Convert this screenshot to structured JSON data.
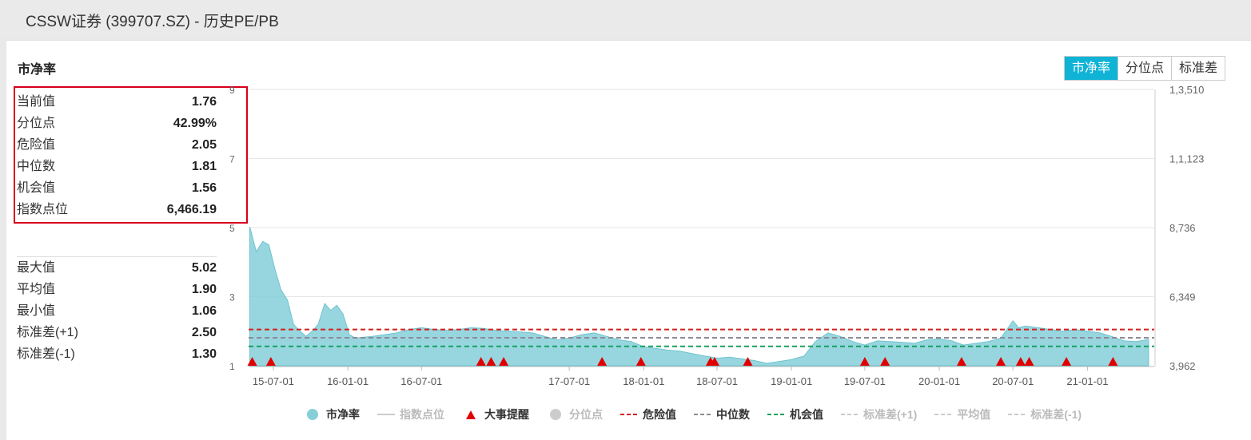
{
  "header": {
    "title": "CSSW证券 (399707.SZ) - 历史PE/PB"
  },
  "section_title": "市净率",
  "tabs": [
    {
      "label": "市净率",
      "active": true
    },
    {
      "label": "分位点",
      "active": false
    },
    {
      "label": "标准差",
      "active": false
    }
  ],
  "stats_top": [
    {
      "label": "当前值",
      "value": "1.76"
    },
    {
      "label": "分位点",
      "value": "42.99%"
    },
    {
      "label": "危险值",
      "value": "2.05"
    },
    {
      "label": "中位数",
      "value": "1.81"
    },
    {
      "label": "机会值",
      "value": "1.56"
    },
    {
      "label": "指数点位",
      "value": "6,466.19"
    }
  ],
  "stats_bottom": [
    {
      "label": "最大值",
      "value": "5.02"
    },
    {
      "label": "平均值",
      "value": "1.90"
    },
    {
      "label": "最小值",
      "value": "1.06"
    },
    {
      "label": "标准差(+1)",
      "value": "2.50"
    },
    {
      "label": "标准差(-1)",
      "value": "1.30"
    }
  ],
  "legend": [
    {
      "label": "市净率",
      "symbol": "dot",
      "color": "#86cfd9",
      "active": true
    },
    {
      "label": "指数点位",
      "symbol": "line",
      "color": "#cccccc",
      "active": false
    },
    {
      "label": "大事提醒",
      "symbol": "triangle",
      "color": "#e00000",
      "active": true
    },
    {
      "label": "分位点",
      "symbol": "dot",
      "color": "#cccccc",
      "active": false
    },
    {
      "label": "危险值",
      "symbol": "dash",
      "color": "#d0211f",
      "active": true
    },
    {
      "label": "中位数",
      "symbol": "dash",
      "color": "#8c8c96",
      "active": true
    },
    {
      "label": "机会值",
      "symbol": "dash",
      "color": "#16a05e",
      "active": true
    },
    {
      "label": "标准差(+1)",
      "symbol": "dash",
      "color": "#cccccc",
      "active": false
    },
    {
      "label": "平均值",
      "symbol": "dash",
      "color": "#cccccc",
      "active": false
    },
    {
      "label": "标准差(-1)",
      "symbol": "dash",
      "color": "#cccccc",
      "active": false
    }
  ],
  "chart_data": {
    "type": "area",
    "series": [
      {
        "name": "市净率",
        "color": "#86cfd9",
        "x": [
          "2015-05-04",
          "2015-05-20",
          "2015-06-05",
          "2015-06-20",
          "2015-07-05",
          "2015-07-20",
          "2015-08-05",
          "2015-08-20",
          "2015-09-05",
          "2015-09-20",
          "2015-10-05",
          "2015-10-20",
          "2015-11-05",
          "2015-11-20",
          "2015-12-05",
          "2015-12-20",
          "2016-01-05",
          "2016-01-20",
          "2016-02-05",
          "2016-03-01",
          "2016-04-01",
          "2016-05-01",
          "2016-06-01",
          "2016-07-01",
          "2016-08-01",
          "2016-09-01",
          "2016-10-01",
          "2016-11-01",
          "2016-12-01",
          "2017-01-01",
          "2017-02-01",
          "2017-03-01",
          "2017-04-01",
          "2017-05-01",
          "2017-06-01",
          "2017-07-01",
          "2017-08-01",
          "2017-09-01",
          "2017-10-01",
          "2017-11-01",
          "2017-12-01",
          "2018-01-01",
          "2018-02-01",
          "2018-03-01",
          "2018-04-01",
          "2018-05-01",
          "2018-06-01",
          "2018-07-01",
          "2018-08-01",
          "2018-09-01",
          "2018-10-01",
          "2018-11-01",
          "2018-12-01",
          "2019-01-01",
          "2019-02-01",
          "2019-03-01",
          "2019-04-01",
          "2019-05-01",
          "2019-06-01",
          "2019-07-01",
          "2019-08-01",
          "2019-09-01",
          "2019-10-01",
          "2019-11-01",
          "2019-12-01",
          "2020-01-01",
          "2020-02-01",
          "2020-03-01",
          "2020-04-01",
          "2020-05-01",
          "2020-06-01",
          "2020-07-01",
          "2020-07-15",
          "2020-08-01",
          "2020-09-01",
          "2020-10-01",
          "2020-11-01",
          "2020-12-01",
          "2021-01-01",
          "2021-02-01",
          "2021-03-01",
          "2021-04-01",
          "2021-05-01",
          "2021-06-01"
        ],
        "values": [
          5.02,
          4.3,
          4.6,
          4.5,
          3.8,
          3.2,
          2.9,
          2.2,
          2.0,
          1.85,
          2.0,
          2.2,
          2.8,
          2.6,
          2.75,
          2.5,
          1.9,
          1.8,
          1.82,
          1.85,
          1.9,
          1.95,
          2.05,
          2.1,
          2.05,
          2.02,
          2.05,
          2.1,
          2.08,
          2.02,
          2.0,
          1.98,
          1.95,
          1.85,
          1.75,
          1.8,
          1.9,
          1.95,
          1.85,
          1.75,
          1.7,
          1.55,
          1.5,
          1.45,
          1.42,
          1.35,
          1.28,
          1.22,
          1.25,
          1.2,
          1.15,
          1.07,
          1.12,
          1.18,
          1.28,
          1.7,
          1.95,
          1.85,
          1.7,
          1.6,
          1.72,
          1.7,
          1.68,
          1.65,
          1.75,
          1.78,
          1.72,
          1.6,
          1.65,
          1.7,
          1.8,
          2.3,
          2.1,
          2.15,
          2.1,
          2.05,
          2.0,
          2.05,
          2.0,
          1.95,
          1.85,
          1.72,
          1.7,
          1.76
        ]
      }
    ],
    "reference_lines": [
      {
        "name": "危险值",
        "value": 2.05,
        "color": "#d0211f"
      },
      {
        "name": "中位数",
        "value": 1.81,
        "color": "#8c8c96"
      },
      {
        "name": "机会值",
        "value": 1.56,
        "color": "#16a05e"
      }
    ],
    "events": [
      "2015-05-10",
      "2015-06-25",
      "2016-11-25",
      "2016-12-20",
      "2017-01-20",
      "2017-09-20",
      "2017-12-25",
      "2018-06-15",
      "2018-06-25",
      "2018-09-15",
      "2019-07-01",
      "2019-08-20",
      "2020-02-25",
      "2020-06-01",
      "2020-07-20",
      "2020-08-10",
      "2020-11-10",
      "2021-03-05"
    ],
    "left_axis": {
      "ticks": [
        1,
        3,
        5,
        7,
        9
      ],
      "range": [
        1,
        9
      ]
    },
    "right_axis": {
      "ticks": [
        "3,962",
        "6,349",
        "8,736",
        "1,1,123",
        "1,3,510"
      ],
      "range": [
        3962,
        13510
      ]
    },
    "x_axis": {
      "ticks": [
        "15-07-01",
        "16-01-01",
        "16-07-01",
        "17-07-01",
        "18-01-01",
        "18-07-01",
        "19-01-01",
        "19-07-01",
        "20-01-01",
        "20-07-01",
        "21-01-01"
      ],
      "tick_dates": [
        "2015-07-01",
        "2016-01-01",
        "2016-07-01",
        "2017-07-01",
        "2018-01-01",
        "2018-07-01",
        "2019-01-01",
        "2019-07-01",
        "2020-01-01",
        "2020-07-01",
        "2021-01-01"
      ],
      "range": [
        "2015-05-01",
        "2021-06-15"
      ]
    },
    "grid": true
  }
}
